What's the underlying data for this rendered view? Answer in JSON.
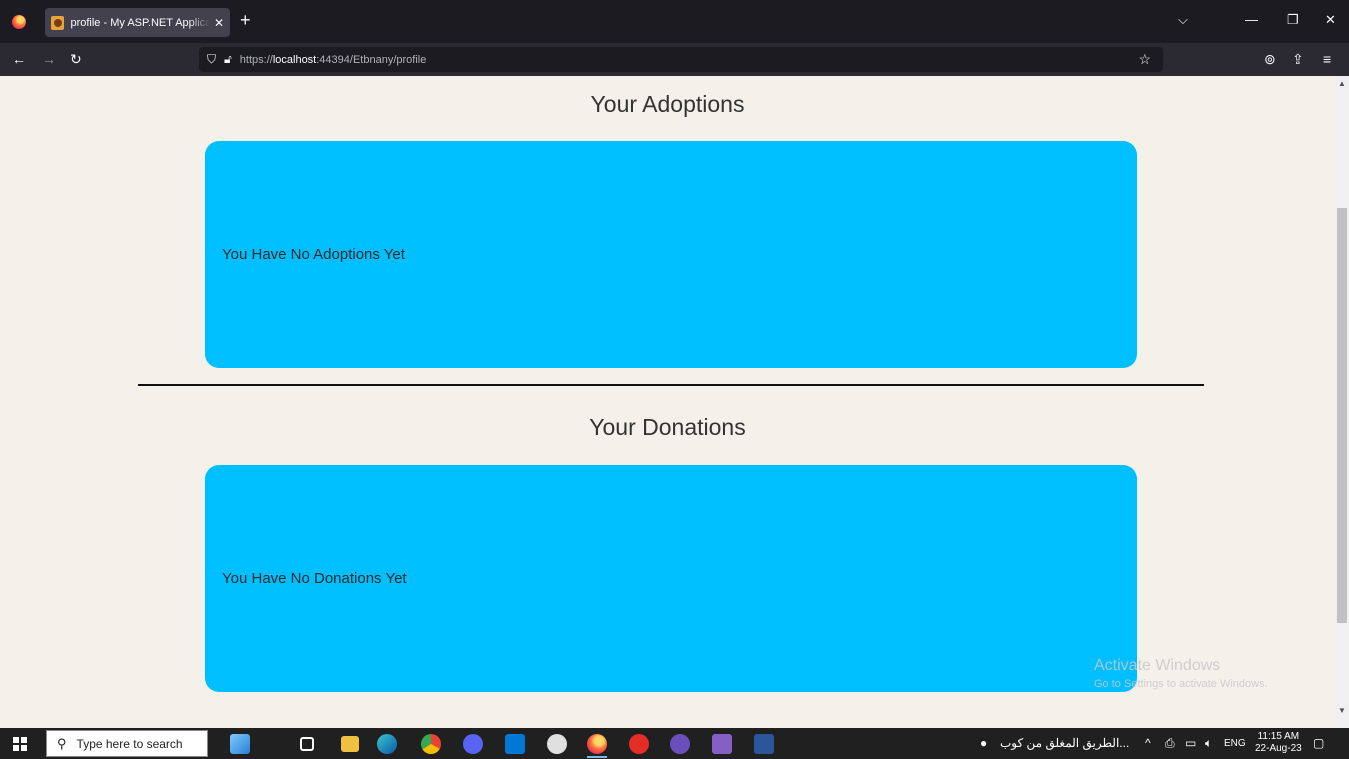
{
  "browser": {
    "tab_title": "profile - My ASP.NET Application",
    "tab_close": "✕",
    "new_tab": "+",
    "url_prefix": "https://",
    "url_host": "localhost",
    "url_rest": ":44394/Etbnany/profile"
  },
  "page": {
    "adoptions": {
      "title": "Your Adoptions",
      "empty_text": "You Have No Adoptions Yet"
    },
    "donations": {
      "title": "Your Donations",
      "empty_text": "You Have No Donations Yet"
    },
    "accent_color": "#00bfff",
    "footer_color": "#0066d6"
  },
  "watermark": {
    "line1": "Activate Windows",
    "line2": "Go to Settings to activate Windows."
  },
  "taskbar": {
    "search_placeholder": "Type here to search",
    "news_text": "الطريق المغلق من كوب...",
    "language": "ENG",
    "time": "11:15 AM",
    "date": "22-Aug-23"
  },
  "icons": [
    "firefox-icon",
    "back-icon",
    "forward-icon",
    "reload-icon",
    "shield-icon",
    "lock-icon",
    "star-icon",
    "pocket-icon",
    "share-icon",
    "menu-icon",
    "windows-start-icon",
    "search-icon"
  ]
}
